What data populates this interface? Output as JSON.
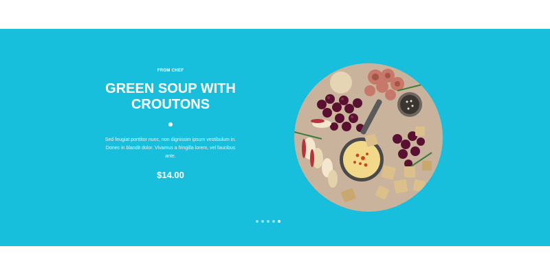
{
  "slide": {
    "eyebrow": "FROM CHEF",
    "title": "GREEN SOUP WITH CROUTONS",
    "description": "Sed feugiat porttitor nunc, non dignissim ipsum vestibulum in. Donec in blandit dolor. Vivamus a fringilla lorem, vel faucibus ante.",
    "price": "$14.00",
    "image_icon": "food-platter-image"
  },
  "pagination": {
    "count": 5,
    "active_index": 4
  },
  "colors": {
    "hero_background": "#17bfdc",
    "text": "#ffffff"
  }
}
